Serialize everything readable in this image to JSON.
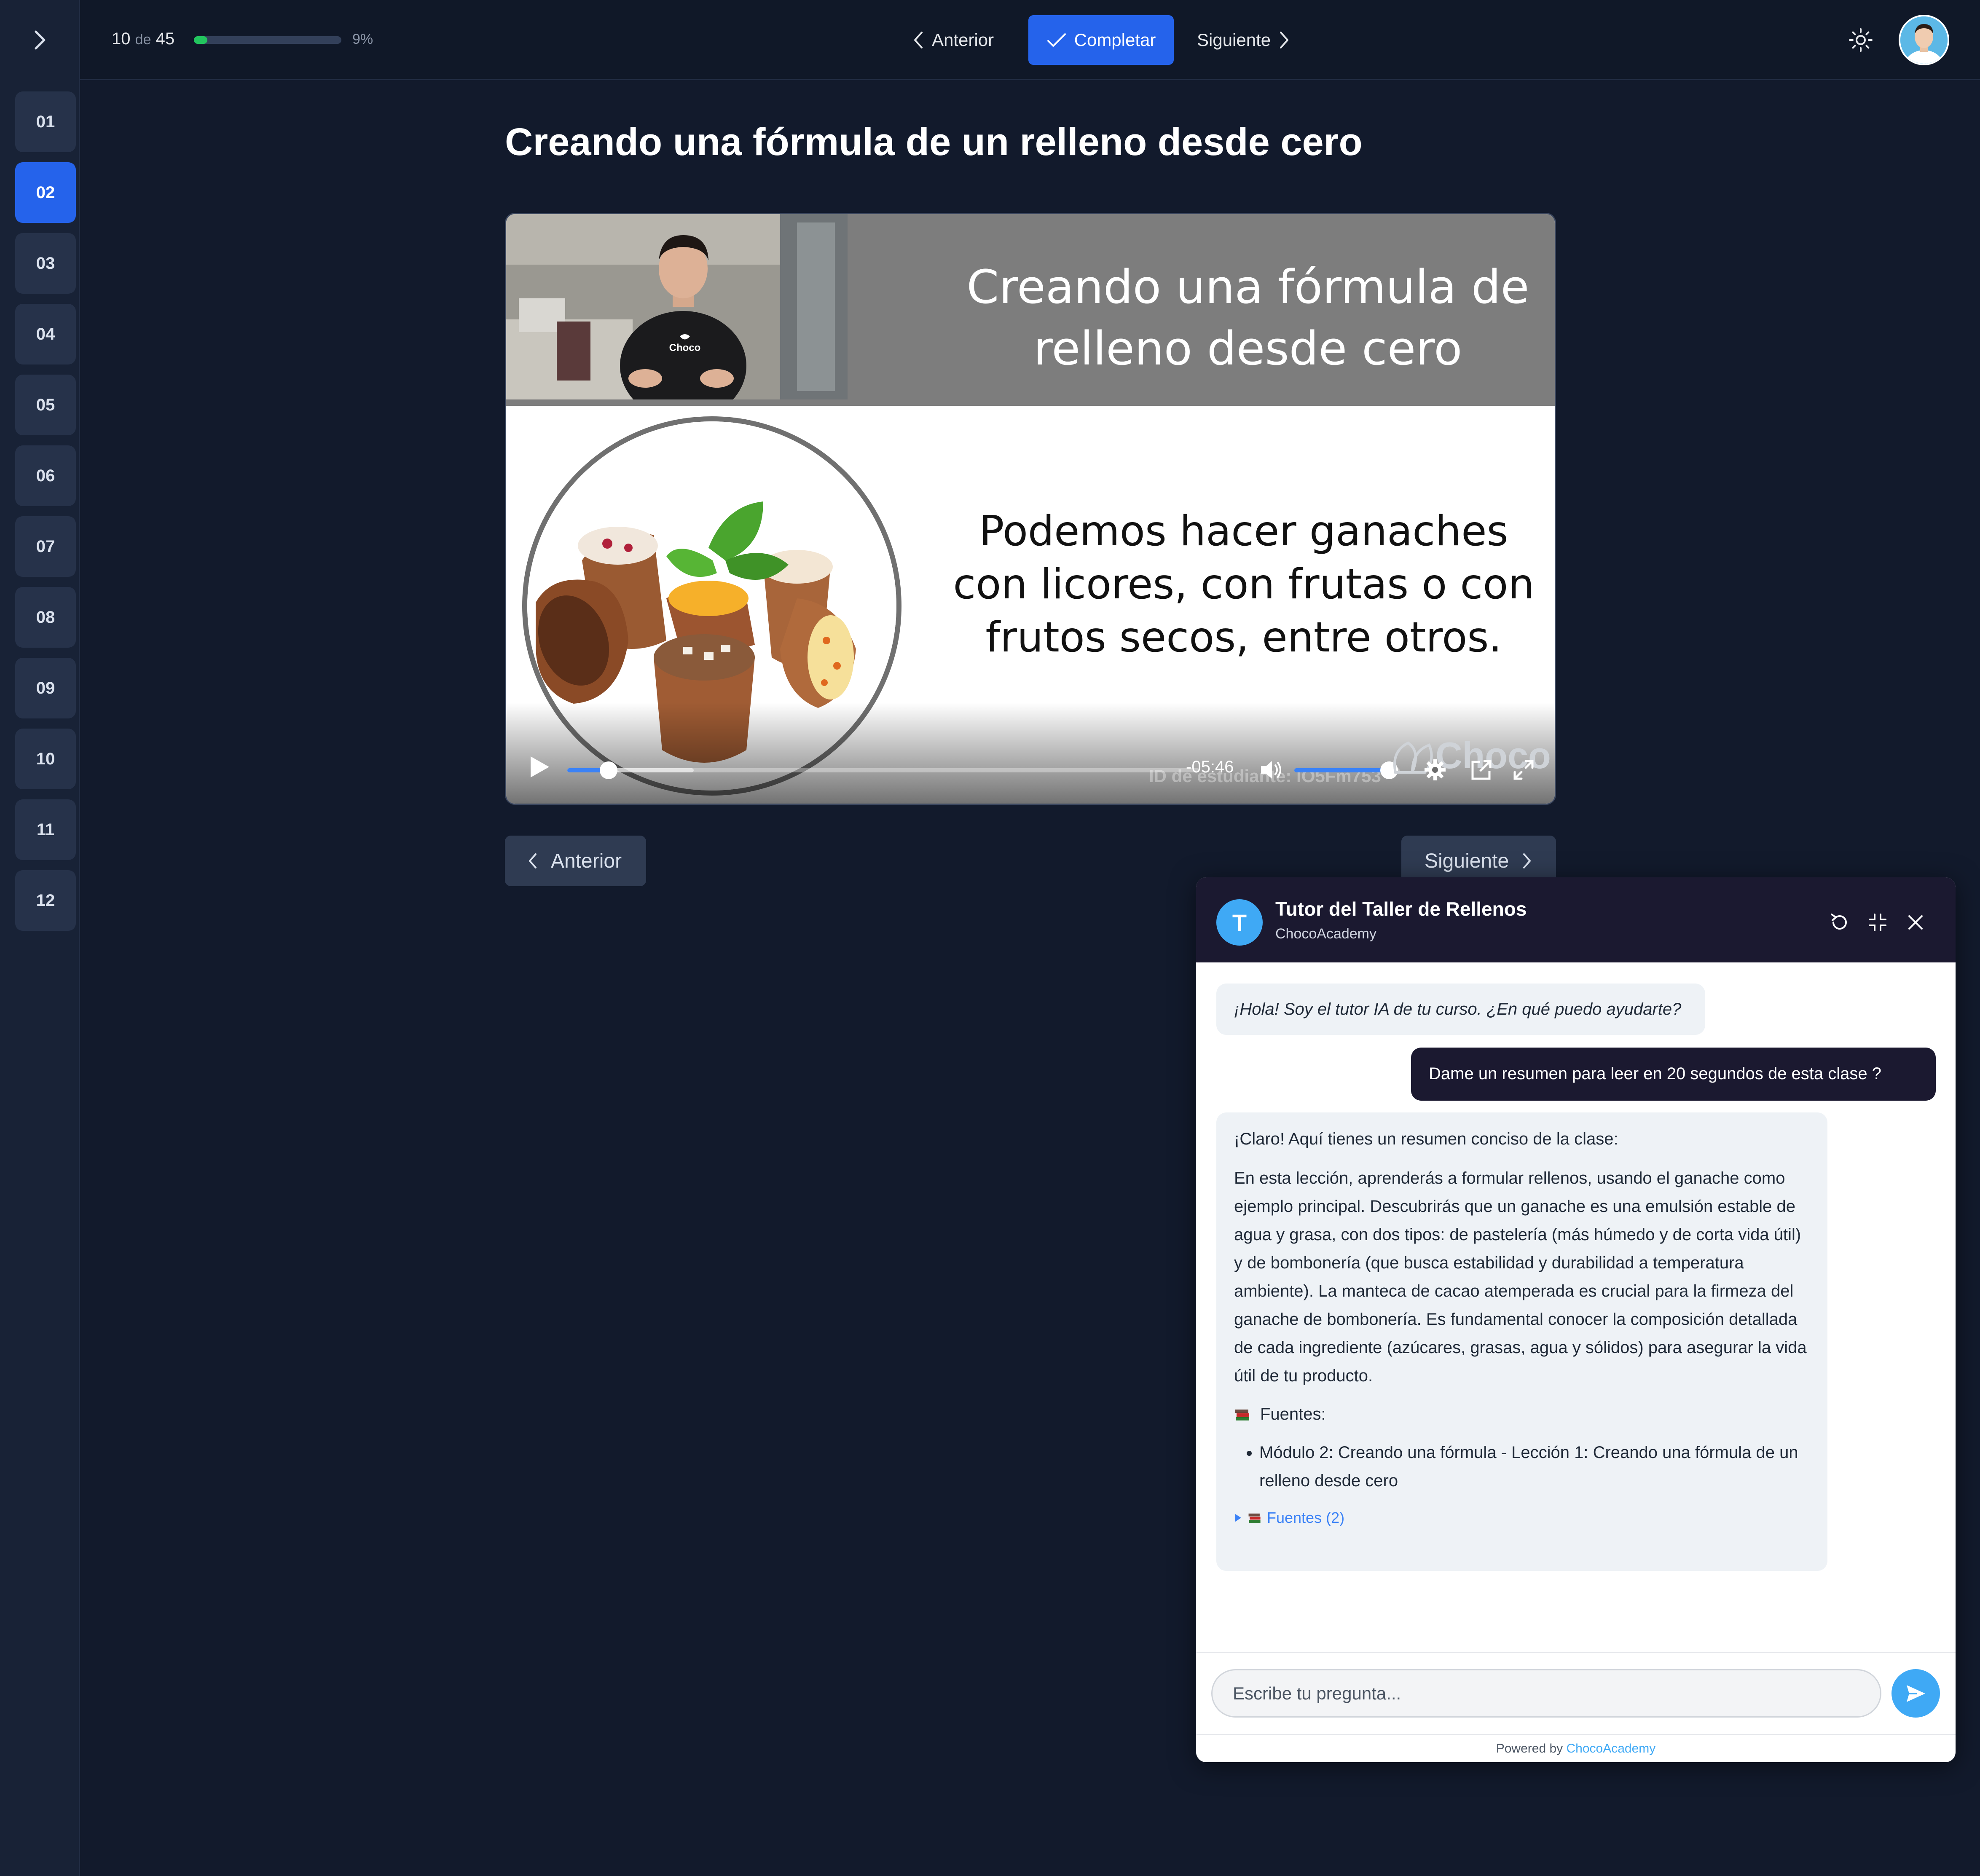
{
  "colors": {
    "background": "#121a2c",
    "sidebar": "#182236",
    "accent": "#2563eb",
    "progress": "#22c55e",
    "chat_header": "#1b1930",
    "chat_accent": "#3fa9f5"
  },
  "sidebar": {
    "toggle_icon": "chevron-right-icon",
    "modules": [
      "01",
      "02",
      "03",
      "04",
      "05",
      "06",
      "07",
      "08",
      "09",
      "10",
      "11",
      "12"
    ],
    "active_module": "02"
  },
  "topbar": {
    "progress_current": "10",
    "progress_of": "de",
    "progress_total": "45",
    "progress_percent_label": "9%",
    "progress_fraction": 0.09,
    "prev_label": "Anterior",
    "complete_label": "Completar",
    "next_label": "Siguiente",
    "theme_icon": "sun-icon"
  },
  "lesson": {
    "title": "Creando una fórmula de un relleno desde cero"
  },
  "video": {
    "slide_title": "Creando una fórmula de relleno desde cero",
    "slide_body": "Podemos hacer ganaches con licores, con frutas o con frutos secos, entre otros.",
    "presenter_shirt_text": "Choco",
    "logo_text": "Choco",
    "time_remaining": "-05:46",
    "watermark": "ID de estudiante: IO5Fm753",
    "played_fraction": 0.065,
    "buffered_fraction": 0.2,
    "volume_fraction": 0.9
  },
  "pager": {
    "prev_label": "Anterior",
    "next_label": "Siguiente"
  },
  "chat": {
    "avatar_letter": "T",
    "title": "Tutor del Taller de Rellenos",
    "subtitle": "ChocoAcademy",
    "messages": {
      "greeting": "¡Hola! Soy el tutor IA de tu curso. ¿En qué puedo ayudarte?",
      "user": "Dame un resumen para leer en 20 segundos de esta clase ?",
      "answer_intro": "¡Claro! Aquí tienes un resumen conciso de la clase:",
      "answer_body": "En esta lección, aprenderás a formular rellenos, usando el ganache como ejemplo principal. Descubrirás que un ganache es una emulsión estable de agua y grasa, con dos tipos: de pastelería (más húmedo y de corta vida útil) y de bombonería (que busca estabilidad y durabilidad a temperatura ambiente). La manteca de cacao atemperada es crucial para la firmeza del ganache de bombonería. Es fundamental conocer la composición detallada de cada ingrediente (azúcares, grasas, agua y sólidos) para asegurar la vida útil de tu producto.",
      "sources_label": "Fuentes:",
      "sources": [
        "Módulo 2: Creando una fórmula - Lección 1: Creando una fórmula de un relleno desde cero"
      ],
      "sources_toggle": "Fuentes (2)"
    },
    "input_placeholder": "Escribe tu pregunta...",
    "footer_prefix": "Powered by",
    "footer_brand": "ChocoAcademy"
  }
}
